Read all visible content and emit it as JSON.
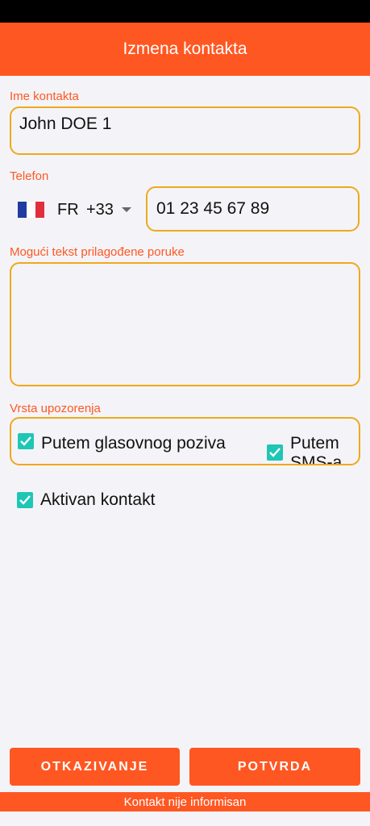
{
  "header": {
    "title": "Izmena kontakta"
  },
  "contact_name": {
    "label": "Ime kontakta",
    "value": "John DOE 1"
  },
  "phone": {
    "label": "Telefon",
    "country_code": "FR",
    "dial_code": "+33",
    "value": "01 23 45 67 89",
    "flag_icon": "france-flag-icon"
  },
  "message": {
    "label": "Mogući tekst prilagođene poruke",
    "value": ""
  },
  "alert_type": {
    "label": "Vrsta upozorenja",
    "options": [
      {
        "label": "Putem glasovnog poziva",
        "checked": true
      },
      {
        "label": "Putem SMS-a",
        "checked": true
      }
    ]
  },
  "active_contact": {
    "label": "Aktivan kontakt",
    "checked": true
  },
  "buttons": {
    "cancel": "OTKAZIVANJE",
    "confirm": "POTVRDA"
  },
  "footer": {
    "status": "Kontakt nije informisan"
  },
  "colors": {
    "accent": "#ff5722",
    "field_border": "#f0a81c",
    "checkbox": "#1fc6b6"
  }
}
